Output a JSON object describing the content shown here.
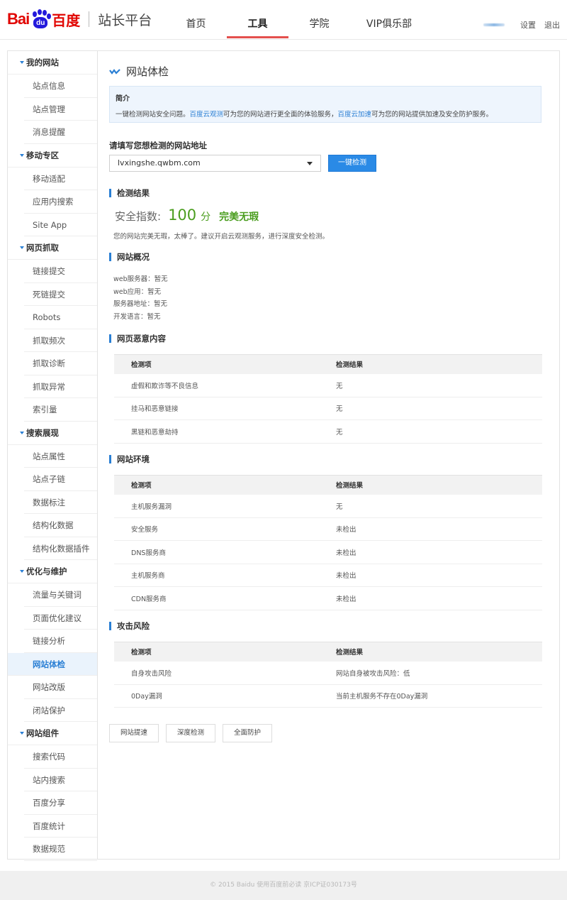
{
  "header": {
    "logo_bai": "Bai",
    "logo_du": "du",
    "logo_cn": "百度",
    "site_name": "站长平台",
    "nav": [
      {
        "label": "首页",
        "active": false
      },
      {
        "label": "工具",
        "active": true
      },
      {
        "label": "学院",
        "active": false
      },
      {
        "label": "VIP俱乐部",
        "active": false
      }
    ],
    "settings": "设置",
    "logout": "退出"
  },
  "sidebar": {
    "groups": [
      {
        "label": "我的网站",
        "items": [
          "站点信息",
          "站点管理",
          "消息提醒"
        ]
      },
      {
        "label": "移动专区",
        "items": [
          "移动适配",
          "应用内搜索",
          "Site App"
        ]
      },
      {
        "label": "网页抓取",
        "items": [
          "链接提交",
          "死链提交",
          "Robots",
          "抓取频次",
          "抓取诊断",
          "抓取异常",
          "索引量"
        ]
      },
      {
        "label": "搜索展现",
        "items": [
          "站点属性",
          "站点子链",
          "数据标注",
          "结构化数据",
          "结构化数据插件"
        ]
      },
      {
        "label": "优化与维护",
        "items": [
          "流量与关键词",
          "页面优化建议",
          "链接分析",
          "网站体检",
          "网站改版",
          "闭站保护"
        ]
      },
      {
        "label": "网站组件",
        "items": [
          "搜索代码",
          "站内搜索",
          "百度分享",
          "百度统计",
          "数据规范"
        ]
      }
    ],
    "active_item": "网站体检"
  },
  "main": {
    "title": "网站体检",
    "intro": {
      "heading": "简介",
      "text_a": "一键检测网站安全问题。",
      "link_a": "百度云观测",
      "text_b": "可为您的网站进行更全面的体验服务，",
      "link_b": "百度云加速",
      "text_c": "可为您的网站提供加速及安全防护服务。"
    },
    "url_label": "请填写您想检测的网站地址",
    "url_value": "lvxingshe.qwbm.com",
    "check_button": "一键检测",
    "result": {
      "title": "检测结果",
      "score_label": "安全指数:",
      "score": "100",
      "unit": "分",
      "verdict": "完美无瑕",
      "note": "您的网站完美无瑕，太棒了。建议开启云观测服务，进行深度安全检测。"
    },
    "overview": {
      "title": "网站概况",
      "lines": [
        "web服务器：暂无",
        "web应用：暂无",
        "服务器地址：暂无",
        "开发语言：暂无"
      ]
    },
    "tables": [
      {
        "title": "网页恶意内容",
        "headers": [
          "检测项",
          "检测结果"
        ],
        "rows": [
          [
            "虚假和欺诈等不良信息",
            "无"
          ],
          [
            "挂马和恶意链接",
            "无"
          ],
          [
            "黑链和恶意劫持",
            "无"
          ]
        ]
      },
      {
        "title": "网站环境",
        "headers": [
          "检测项",
          "检测结果"
        ],
        "rows": [
          [
            "主机服务漏洞",
            "无"
          ],
          [
            "安全服务",
            "未检出"
          ],
          [
            "DNS服务商",
            "未检出"
          ],
          [
            "主机服务商",
            "未检出"
          ],
          [
            "CDN服务商",
            "未检出"
          ]
        ]
      },
      {
        "title": "攻击风险",
        "headers": [
          "检测项",
          "检测结果"
        ],
        "rows": [
          [
            "自身攻击风险",
            "网站自身被攻击风险：低"
          ],
          [
            "0Day漏洞",
            "当前主机服务不存在0Day漏洞"
          ]
        ]
      }
    ],
    "bottom_buttons": [
      "网站提速",
      "深度检测",
      "全面防护"
    ]
  },
  "footer": "© 2015 Baidu 使用百度前必读 京ICP证030173号",
  "colors": {
    "accent": "#2a7fd4",
    "brand_red": "#e10602",
    "brand_blue": "#2319dc",
    "success": "#4a9d1e",
    "nav_underline": "#e4504d"
  }
}
